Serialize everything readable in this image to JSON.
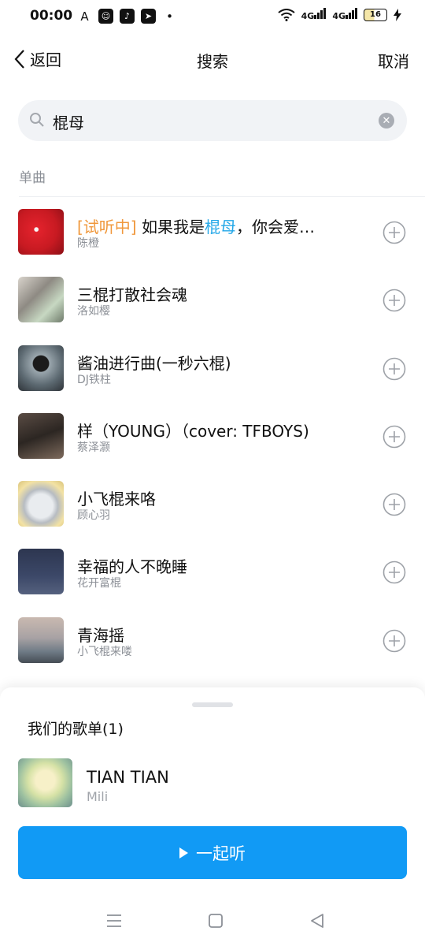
{
  "status": {
    "time": "00:00",
    "battery": "16",
    "net1": "4G",
    "net2": "4G"
  },
  "header": {
    "back_label": "返回",
    "title": "搜索",
    "cancel_label": "取消"
  },
  "search": {
    "value": "棍母"
  },
  "section_label": "单曲",
  "songs": [
    {
      "tag": "[试听中]",
      "title_before": " 如果我是",
      "title_highlight": "棍母",
      "title_after": "，你会爱…",
      "artist": "陈橙"
    },
    {
      "title": "三棍打散社会魂",
      "artist": "洛如樱"
    },
    {
      "title": "酱油进行曲(一秒六棍)",
      "artist": "DJ铁柱"
    },
    {
      "title": "样（YOUNG）（cover: TFBOYS)",
      "artist": "蔡泽灏"
    },
    {
      "title": "小飞棍来咯",
      "artist": "顾心羽"
    },
    {
      "title": "幸福的人不晚睡",
      "artist": "花开富棍"
    },
    {
      "title": "青海摇",
      "artist": "小飞棍来喽"
    }
  ],
  "playlist": {
    "title": "我们的歌单(1)",
    "track_title": "TIAN TIAN",
    "track_artist": "Mili",
    "listen_label": "一起听"
  },
  "colors": {
    "accent": "#119af5",
    "highlight": "#22a7e8",
    "tag": "#f0983c"
  },
  "icons": [
    "back-chevron-icon",
    "search-icon",
    "clear-icon",
    "add-icon",
    "play-icon",
    "menu-icon",
    "home-icon",
    "back-icon"
  ]
}
